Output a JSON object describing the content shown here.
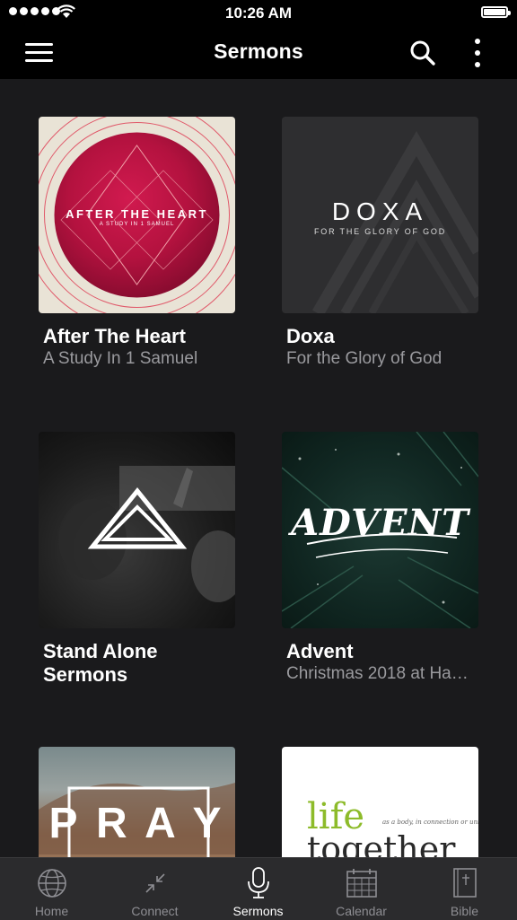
{
  "status_bar": {
    "time": "10:26 AM"
  },
  "nav": {
    "title": "Sermons"
  },
  "series": [
    {
      "title": "After The Heart",
      "subtitle": "A Study In 1 Samuel",
      "art_text": "AFTER THE HEART",
      "art_subtext": "A STUDY IN 1 SAMUEL"
    },
    {
      "title": "Doxa",
      "subtitle": "For the Glory of God",
      "art_text": "DOXA",
      "art_subtext": "FOR THE GLORY OF GOD"
    },
    {
      "title": "Stand Alone Sermons",
      "subtitle": ""
    },
    {
      "title": "Advent",
      "subtitle": "Christmas 2018 at Ha…",
      "art_text": "ADVENT"
    },
    {
      "title": "",
      "subtitle": "",
      "art_text": "P R A Y"
    },
    {
      "title": "",
      "subtitle": "",
      "art_text": "life",
      "art_text2": "together",
      "art_small": "as a body, in connection or union"
    }
  ],
  "tabs": [
    {
      "label": "Home",
      "icon": "globe-icon"
    },
    {
      "label": "Connect",
      "icon": "connect-icon"
    },
    {
      "label": "Sermons",
      "icon": "microphone-icon",
      "active": true
    },
    {
      "label": "Calendar",
      "icon": "calendar-icon"
    },
    {
      "label": "Bible",
      "icon": "bible-icon"
    }
  ]
}
